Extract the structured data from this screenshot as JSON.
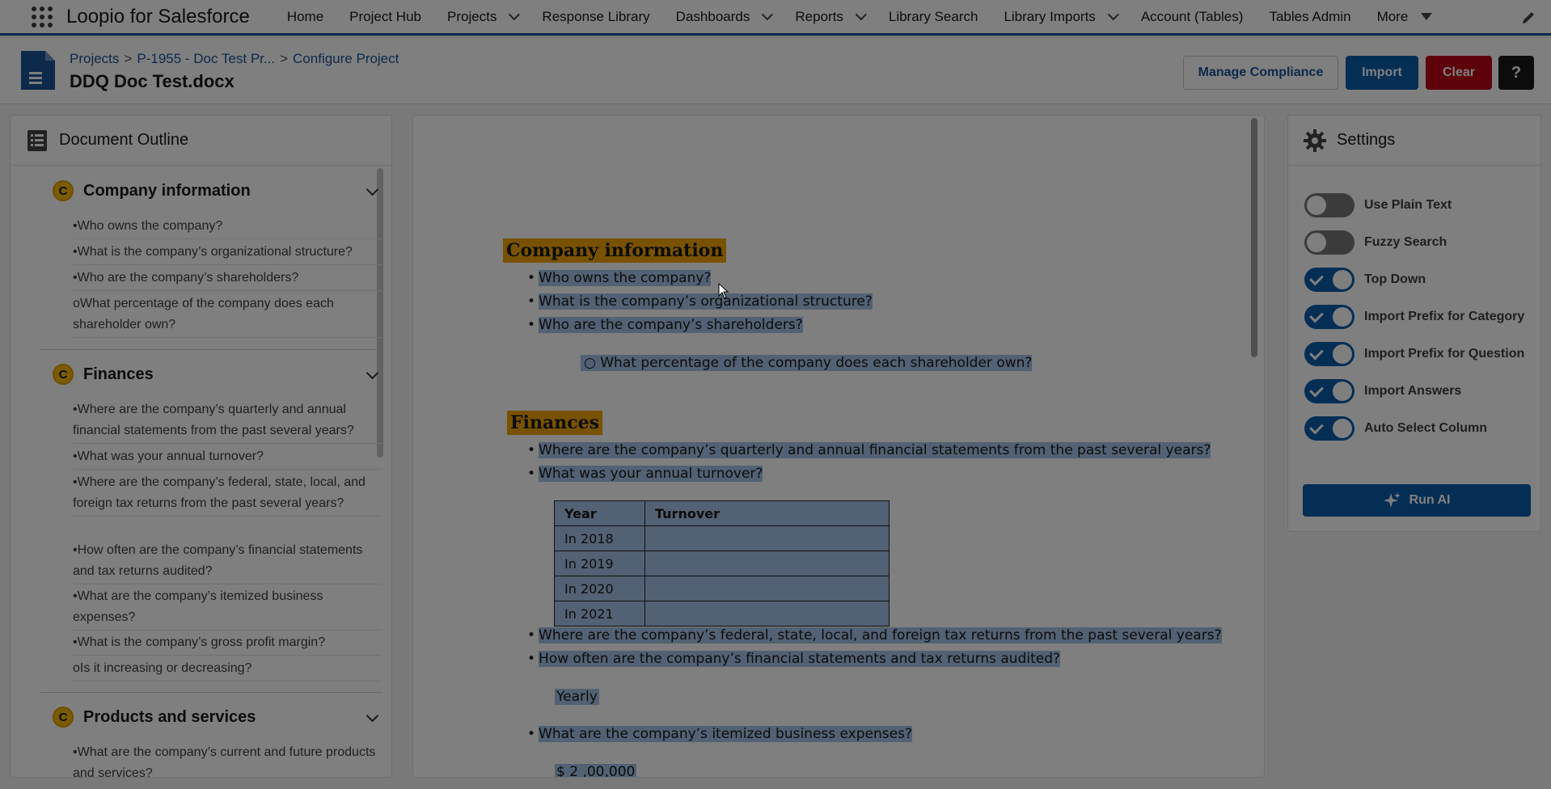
{
  "app": {
    "name": "Loopio for Salesforce"
  },
  "nav": {
    "items": [
      {
        "label": "Home",
        "chevron": false
      },
      {
        "label": "Project Hub",
        "chevron": false
      },
      {
        "label": "Projects",
        "chevron": true
      },
      {
        "label": "Response Library",
        "chevron": false
      },
      {
        "label": "Dashboards",
        "chevron": true
      },
      {
        "label": "Reports",
        "chevron": true
      },
      {
        "label": "Library Search",
        "chevron": false
      },
      {
        "label": "Library Imports",
        "chevron": true
      },
      {
        "label": "Account (Tables)",
        "chevron": false
      },
      {
        "label": "Tables Admin",
        "chevron": false
      },
      {
        "label": "More",
        "chevron": false,
        "triangle": true
      }
    ]
  },
  "header": {
    "breadcrumb": [
      "Projects",
      "P-1955 - Doc Test Pr...",
      "Configure Project"
    ],
    "breadcrumb_sep": ">",
    "title": "DDQ Doc Test.docx",
    "buttons": {
      "manage_compliance": "Manage Compliance",
      "import": "Import",
      "clear": "Clear",
      "help": "?"
    }
  },
  "outline": {
    "title": "Document Outline",
    "badge": "C",
    "sections": [
      {
        "title": "Company information",
        "questions": [
          "•Who owns the company?",
          "•What is the company’s organizational structure?",
          "•Who are the company’s shareholders?",
          "oWhat percentage of the company does each shareholder own?"
        ]
      },
      {
        "title": "Finances",
        "questions": [
          "•Where are the company’s quarterly and annual financial statements from the past several years?",
          "•What was your annual turnover?",
          "•Where are the company’s federal, state, local, and foreign tax returns from the past several years?",
          "•How often are the company’s financial statements and tax returns audited?",
          "•What are the company’s itemized business expenses?",
          "•What is the company’s gross profit margin?",
          "oIs it increasing or decreasing?"
        ]
      },
      {
        "title": "Products and services",
        "questions": [
          "•What are the company’s current and future products and services?"
        ]
      }
    ]
  },
  "document": {
    "cat1": "Company information",
    "q1": "Who owns the company?",
    "q2": "What is the company’s organizational structure?",
    "q3": "Who are the company’s shareholders?",
    "q4": "What percentage of the company does each shareholder own?",
    "cat2": "Finances",
    "q5": "Where are the company’s quarterly and annual financial statements from the past several years?",
    "q6": "What was your annual turnover?",
    "table": {
      "headers": [
        "Year",
        "Turnover"
      ],
      "rows": [
        "In 2018",
        "In 2019",
        "In 2020",
        "In 2021"
      ]
    },
    "q7": "Where are the company’s federal, state, local, and foreign tax returns from the past several years?",
    "q8": "How often are the company’s financial statements and tax returns audited?",
    "a8": "Yearly",
    "q9": "What are the company’s itemized business expenses?",
    "a9": "$ 2 ,00,000",
    "bullet": "•",
    "sub_bullet": "○"
  },
  "settings": {
    "title": "Settings",
    "toggles": [
      {
        "label": "Use Plain Text",
        "on": false
      },
      {
        "label": "Fuzzy Search",
        "on": false
      },
      {
        "label": "Top Down",
        "on": true
      },
      {
        "label": "Import Prefix for Category",
        "on": true
      },
      {
        "label": "Import Prefix for Question",
        "on": true
      },
      {
        "label": "Import Answers",
        "on": true
      },
      {
        "label": "Auto Select Column",
        "on": true
      }
    ],
    "run_ai": "Run AI"
  },
  "colors": {
    "brand": "#1b5297",
    "primary": "#0b5cab",
    "danger": "#ba0517",
    "category_highlight": "#f2a500",
    "question_highlight": "#a4c2e6"
  }
}
